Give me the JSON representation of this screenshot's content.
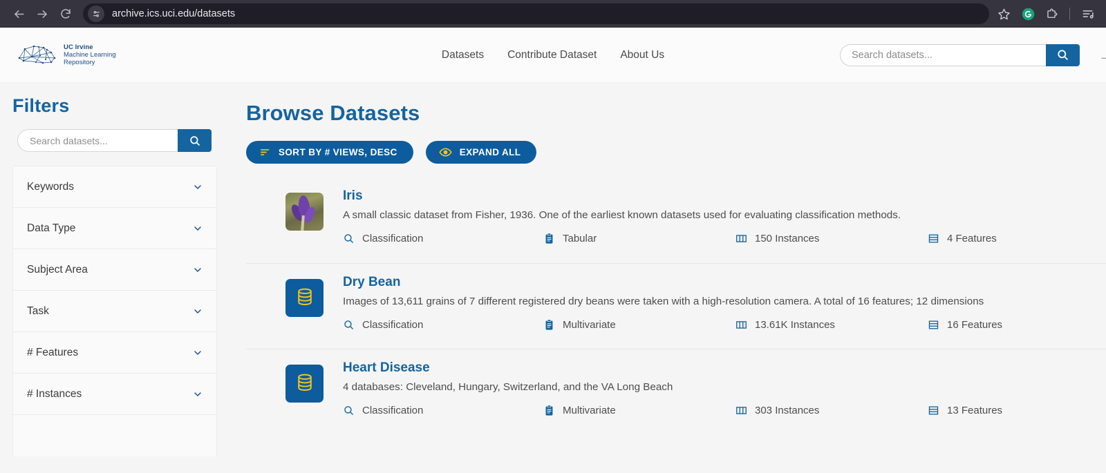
{
  "browser": {
    "url": "archive.ics.uci.edu/datasets",
    "back_label": "Back",
    "forward_label": "Forward",
    "reload_label": "Reload",
    "site_info_label": "View site information",
    "bookmark_label": "Bookmark this tab",
    "grammarly_label": "Grammarly",
    "extensions_label": "Extensions",
    "menu_label": "Customize and control"
  },
  "header": {
    "logo": {
      "line1": "UC Irvine",
      "line2": "Machine Learning",
      "line3": "Repository"
    },
    "nav": [
      {
        "label": "Datasets"
      },
      {
        "label": "Contribute Dataset"
      },
      {
        "label": "About Us"
      }
    ],
    "search": {
      "placeholder": "Search datasets...",
      "value": "",
      "button_label": "Search"
    }
  },
  "sidebar": {
    "title": "Filters",
    "search": {
      "placeholder": "Search datasets...",
      "value": "",
      "button_label": "Search"
    },
    "filters": [
      {
        "label": "Keywords"
      },
      {
        "label": "Data Type"
      },
      {
        "label": "Subject Area"
      },
      {
        "label": "Task"
      },
      {
        "label": "# Features"
      },
      {
        "label": "# Instances"
      },
      {
        "label": ""
      }
    ]
  },
  "main": {
    "title": "Browse Datasets",
    "buttons": {
      "sort": "SORT BY  # VIEWS, DESC",
      "expand": "EXPAND ALL"
    },
    "datasets": [
      {
        "name": "Iris",
        "description": "A small classic dataset from Fisher, 1936. One of the earliest known datasets used for evaluating classification methods.",
        "thumbnail": "iris-flower-photo",
        "task": "Classification",
        "data_type": "Tabular",
        "instances": "150 Instances",
        "features": "4 Features"
      },
      {
        "name": "Dry Bean",
        "description": "Images of 13,611 grains of 7 different registered dry beans were taken with a high-resolution camera. A total of 16 features; 12 dimensions",
        "thumbnail": "database-placeholder",
        "task": "Classification",
        "data_type": "Multivariate",
        "instances": "13.61K Instances",
        "features": "16 Features"
      },
      {
        "name": "Heart Disease",
        "description": "4 databases: Cleveland, Hungary, Switzerland, and the VA Long Beach",
        "thumbnail": "database-placeholder",
        "task": "Classification",
        "data_type": "Multivariate",
        "instances": "303 Instances",
        "features": "13 Features"
      }
    ]
  },
  "colors": {
    "brand_blue": "#1464a0",
    "pill_blue": "#0d5c9e",
    "accent_yellow": "#f5c518",
    "chrome_bg": "#35343f",
    "page_bg": "#f5f5f5"
  }
}
